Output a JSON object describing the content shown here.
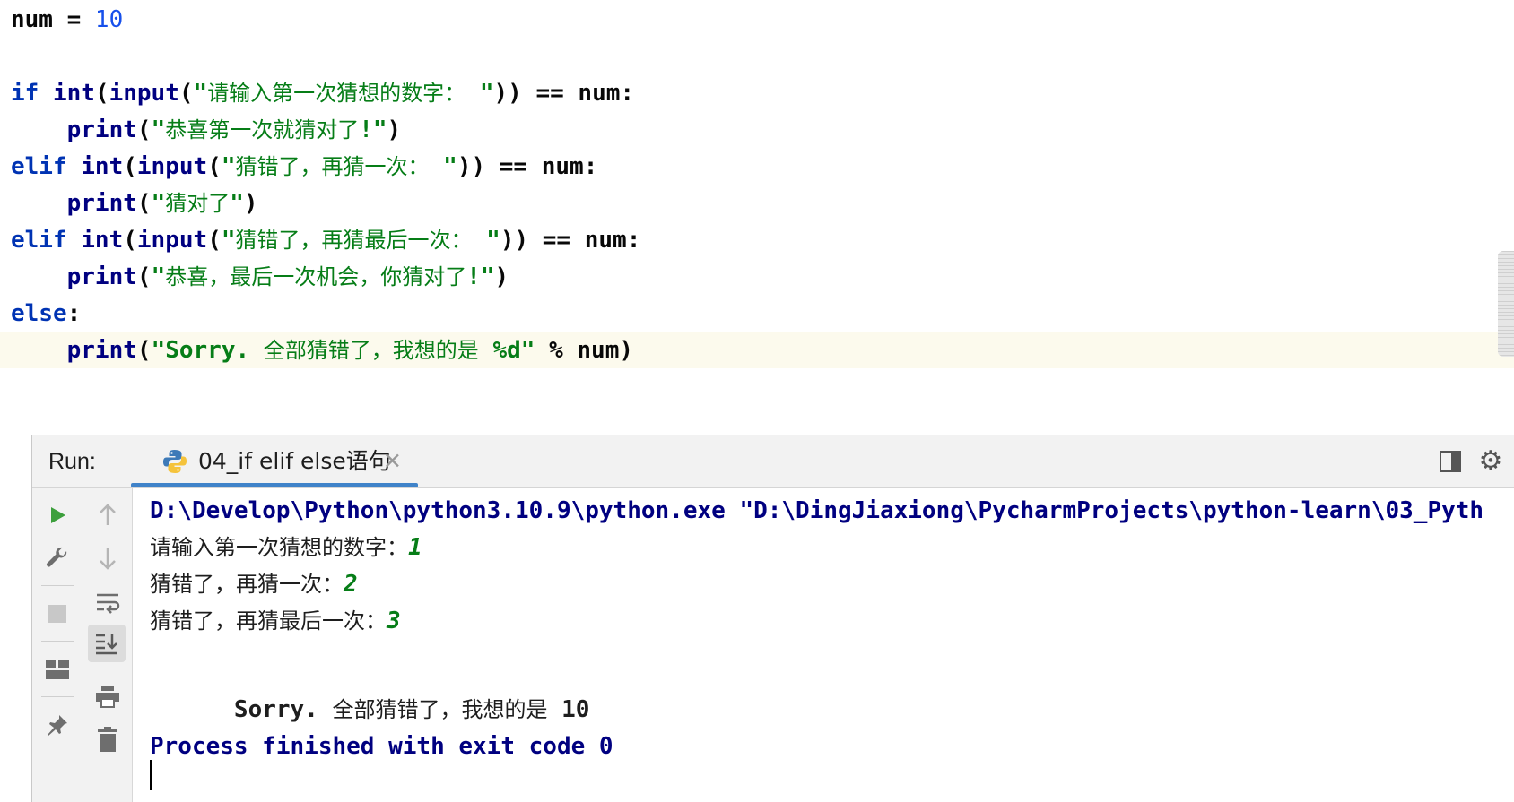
{
  "editor": {
    "lines": [
      {
        "parts": [
          {
            "t": "num = ",
            "c": ""
          },
          {
            "t": "10",
            "c": "tok-num"
          }
        ]
      },
      {
        "parts": []
      },
      {
        "parts": [
          {
            "t": "if ",
            "c": "tok-kw"
          },
          {
            "t": "int",
            "c": "tok-fn"
          },
          {
            "t": "(",
            "c": ""
          },
          {
            "t": "input",
            "c": "tok-fn"
          },
          {
            "t": "(",
            "c": ""
          },
          {
            "t": "\"",
            "c": "tok-str"
          },
          {
            "t": "请输入第一次猜想的数字：",
            "c": "tok-cjk"
          },
          {
            "t": " \"",
            "c": "tok-str"
          },
          {
            "t": ")) == num:",
            "c": ""
          }
        ]
      },
      {
        "parts": [
          {
            "t": "    ",
            "c": ""
          },
          {
            "t": "print",
            "c": "tok-fn"
          },
          {
            "t": "(",
            "c": ""
          },
          {
            "t": "\"",
            "c": "tok-str"
          },
          {
            "t": "恭喜第一次就猜对了",
            "c": "tok-cjk"
          },
          {
            "t": "!\"",
            "c": "tok-str"
          },
          {
            "t": ")",
            "c": ""
          }
        ]
      },
      {
        "parts": [
          {
            "t": "elif ",
            "c": "tok-kw"
          },
          {
            "t": "int",
            "c": "tok-fn"
          },
          {
            "t": "(",
            "c": ""
          },
          {
            "t": "input",
            "c": "tok-fn"
          },
          {
            "t": "(",
            "c": ""
          },
          {
            "t": "\"",
            "c": "tok-str"
          },
          {
            "t": "猜错了，再猜一次：",
            "c": "tok-cjk"
          },
          {
            "t": " \"",
            "c": "tok-str"
          },
          {
            "t": ")) == num:",
            "c": ""
          }
        ]
      },
      {
        "parts": [
          {
            "t": "    ",
            "c": ""
          },
          {
            "t": "print",
            "c": "tok-fn"
          },
          {
            "t": "(",
            "c": ""
          },
          {
            "t": "\"",
            "c": "tok-str"
          },
          {
            "t": "猜对了",
            "c": "tok-cjk"
          },
          {
            "t": "\"",
            "c": "tok-str"
          },
          {
            "t": ")",
            "c": ""
          }
        ]
      },
      {
        "parts": [
          {
            "t": "elif ",
            "c": "tok-kw"
          },
          {
            "t": "int",
            "c": "tok-fn"
          },
          {
            "t": "(",
            "c": ""
          },
          {
            "t": "input",
            "c": "tok-fn"
          },
          {
            "t": "(",
            "c": ""
          },
          {
            "t": "\"",
            "c": "tok-str"
          },
          {
            "t": "猜错了，再猜最后一次：",
            "c": "tok-cjk"
          },
          {
            "t": " \"",
            "c": "tok-str"
          },
          {
            "t": ")) == num:",
            "c": ""
          }
        ]
      },
      {
        "parts": [
          {
            "t": "    ",
            "c": ""
          },
          {
            "t": "print",
            "c": "tok-fn"
          },
          {
            "t": "(",
            "c": ""
          },
          {
            "t": "\"",
            "c": "tok-str"
          },
          {
            "t": "恭喜，最后一次机会，你猜对了",
            "c": "tok-cjk"
          },
          {
            "t": "!\"",
            "c": "tok-str"
          },
          {
            "t": ")",
            "c": ""
          }
        ]
      },
      {
        "parts": [
          {
            "t": "else",
            "c": "tok-kw"
          },
          {
            "t": ":",
            "c": ""
          }
        ]
      },
      {
        "parts": [
          {
            "t": "    ",
            "c": ""
          },
          {
            "t": "print",
            "c": "tok-fn"
          },
          {
            "t": "(",
            "c": ""
          },
          {
            "t": "\"Sorry. ",
            "c": "tok-str"
          },
          {
            "t": "全部猜错了，我想的是",
            "c": "tok-cjk"
          },
          {
            "t": " %d\"",
            "c": "tok-str"
          },
          {
            "t": " % num)",
            "c": ""
          }
        ]
      }
    ]
  },
  "run": {
    "label": "Run:",
    "tab_title": "04_if elif else语句",
    "tab_close": "✕",
    "settings_glyph": "⚙"
  },
  "icons": {
    "left": [
      "run-icon",
      "wrench-icon",
      "stop-icon",
      "layout-grid-icon",
      "pin-icon"
    ],
    "right": [
      "arrow-up-icon",
      "arrow-down-icon",
      "soft-wrap-icon",
      "scroll-to-end-icon",
      "print-icon",
      "trash-icon"
    ]
  },
  "console": {
    "command": "D:\\Develop\\Python\\python3.10.9\\python.exe \"D:\\DingJiaxiong\\PycharmProjects\\python-learn\\03_Pyth",
    "lines": [
      {
        "prompt": "请输入第一次猜想的数字：",
        "input": "1"
      },
      {
        "prompt": "猜错了，再猜一次：",
        "input": "2"
      },
      {
        "prompt": "猜错了，再猜最后一次：",
        "input": "3"
      }
    ],
    "result_en": "Sorry. ",
    "result_cn": "全部猜错了，我想的是",
    "result_num": " 10",
    "finish": "Process finished with exit code 0"
  },
  "colors": {
    "keyword": "#0033b3",
    "string": "#067d17",
    "number": "#1750eb",
    "tab_underline": "#4083c9",
    "run_green": "#3c9f3c"
  }
}
